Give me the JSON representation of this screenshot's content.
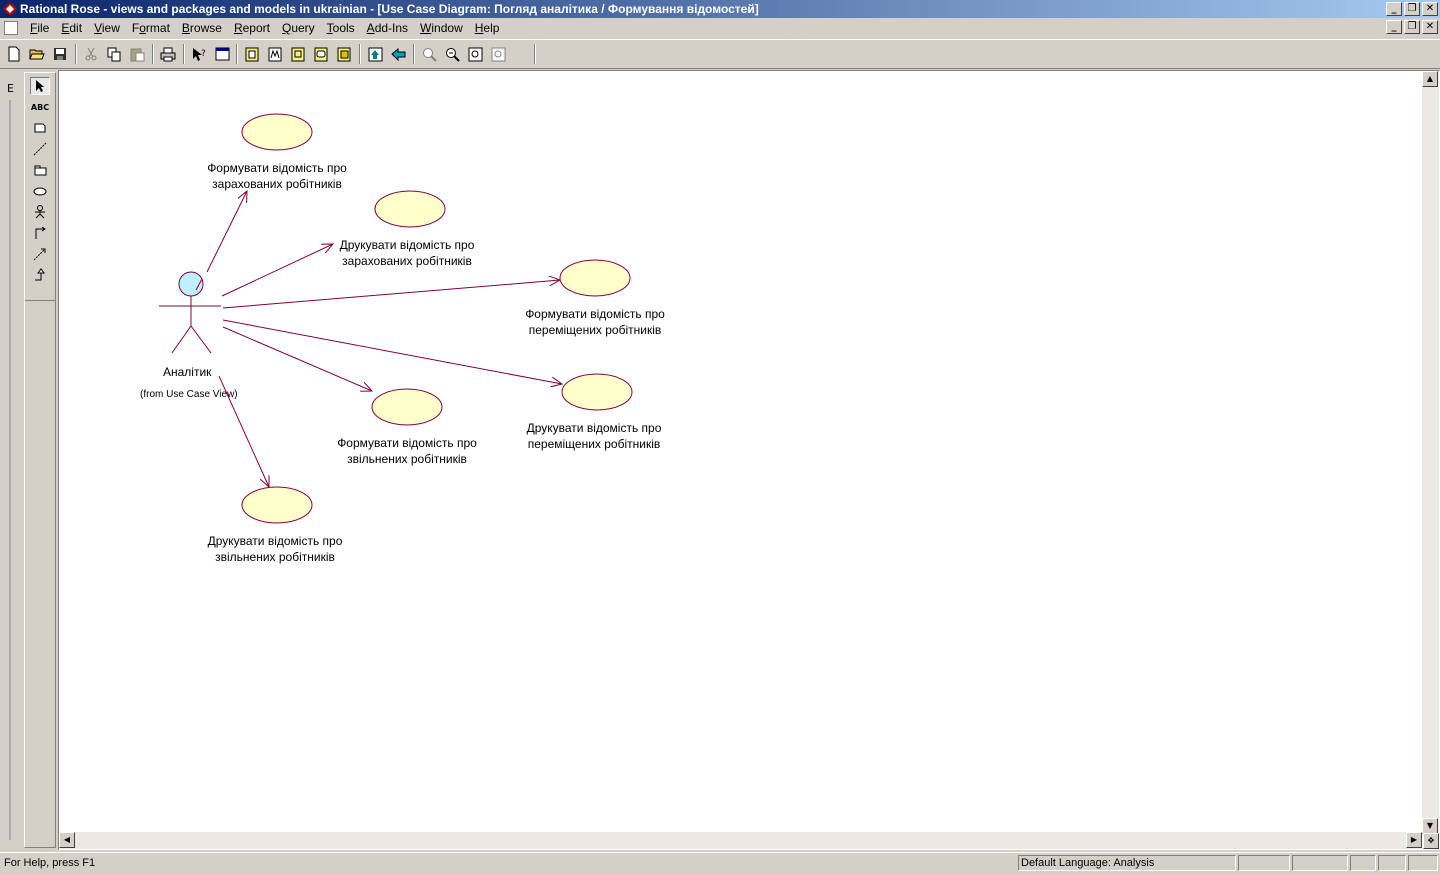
{
  "window": {
    "title": "Rational Rose - views and packages and models in ukrainian - [Use Case Diagram: Погляд аналітика / Формування відомостей]"
  },
  "menu": {
    "items": [
      {
        "label": "File",
        "hotkey": "F"
      },
      {
        "label": "Edit",
        "hotkey": "E"
      },
      {
        "label": "View",
        "hotkey": "V"
      },
      {
        "label": "Format",
        "hotkey": "o"
      },
      {
        "label": "Browse",
        "hotkey": "B"
      },
      {
        "label": "Report",
        "hotkey": "R"
      },
      {
        "label": "Query",
        "hotkey": "Q"
      },
      {
        "label": "Tools",
        "hotkey": "T"
      },
      {
        "label": "Add-Ins",
        "hotkey": "A"
      },
      {
        "label": "Window",
        "hotkey": "W"
      },
      {
        "label": "Help",
        "hotkey": "H"
      }
    ]
  },
  "palette": {
    "text_tool_label": "ABC"
  },
  "diagram": {
    "actor": {
      "name": "Аналітик",
      "source": "(from Use Case View)"
    },
    "use_cases": [
      {
        "line1": "Формувати відомість про",
        "line2": "зарахованих робітників"
      },
      {
        "line1": "Друкувати відомість про",
        "line2": "зарахованих робітників"
      },
      {
        "line1": "Формувати відомість про",
        "line2": "переміщених робітників"
      },
      {
        "line1": "Формувати відомість про",
        "line2": "звільнених робітників"
      },
      {
        "line1": "Друкувати відомість про",
        "line2": "переміщених робітників"
      },
      {
        "line1": "Друкувати відомість про",
        "line2": "звільнених робітників"
      }
    ],
    "colors": {
      "use_case_fill": "#ffffcc",
      "line": "#800040",
      "actor_head_fill": "#c0f0ff"
    }
  },
  "status": {
    "help_text": "For Help, press F1",
    "language": "Default Language: Analysis"
  }
}
